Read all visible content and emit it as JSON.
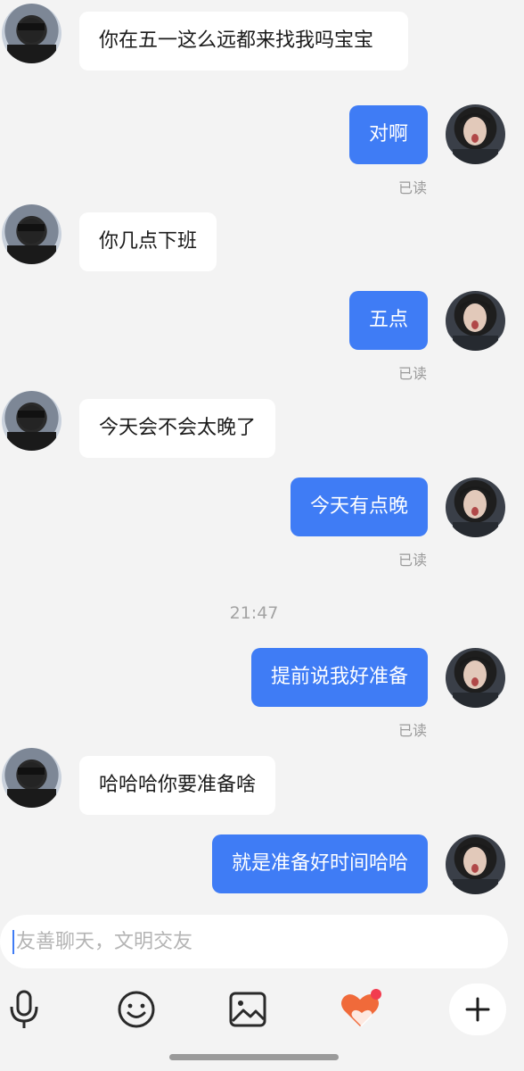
{
  "messages": [
    {
      "side": "in",
      "text": "你在五一这么远都来找我吗宝宝"
    },
    {
      "side": "out",
      "text": "对啊",
      "status": "已读"
    },
    {
      "side": "in",
      "text": "你几点下班"
    },
    {
      "side": "out",
      "text": "五点",
      "status": "已读"
    },
    {
      "side": "in",
      "text": "今天会不会太晚了"
    },
    {
      "side": "out",
      "text": "今天有点晚",
      "status": "已读"
    },
    {
      "side": "out",
      "text": "提前说我好准备",
      "status": "已读"
    },
    {
      "side": "in",
      "text": "哈哈哈你要准备啥"
    },
    {
      "side": "out",
      "text": "就是准备好时间哈哈"
    }
  ],
  "timestamp": "21:47",
  "input": {
    "placeholder": "友善聊天，文明交友",
    "value": ""
  },
  "toolbar": [
    "microphone-icon",
    "emoji-icon",
    "image-icon",
    "heart-gift-icon",
    "plus-icon"
  ],
  "colors": {
    "outgoing_bubble": "#3f7cf5",
    "incoming_bubble": "#ffffff",
    "background": "#f3f3f3",
    "badge": "#f23c4f"
  }
}
